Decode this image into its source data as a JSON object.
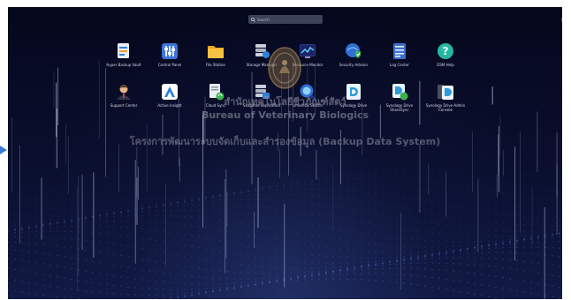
{
  "search": {
    "placeholder": "Search"
  },
  "apps": [
    {
      "label": "Hyper Backup Vault",
      "icon": "hyper-backup-icon"
    },
    {
      "label": "Control Panel",
      "icon": "control-panel-icon"
    },
    {
      "label": "File Station",
      "icon": "file-station-icon"
    },
    {
      "label": "Storage Manager",
      "icon": "storage-manager-icon"
    },
    {
      "label": "Resource Monitor",
      "icon": "resource-monitor-icon"
    },
    {
      "label": "Security Advisor",
      "icon": "security-advisor-icon"
    },
    {
      "label": "Log Center",
      "icon": "log-center-icon"
    },
    {
      "label": "DSM Help",
      "icon": "help-icon"
    },
    {
      "label": "Support Center",
      "icon": "support-center-icon"
    },
    {
      "label": "Active Insight",
      "icon": "active-insight-icon"
    },
    {
      "label": "Cloud Sync",
      "icon": "cloud-sync-icon"
    },
    {
      "label": "Snapshot Replication",
      "icon": "snapshot-icon"
    },
    {
      "label": "Universal Search",
      "icon": "universal-search-icon"
    },
    {
      "label": "Synology Drive",
      "icon": "synology-drive-icon"
    },
    {
      "label": "Synology Drive ShareSync",
      "icon": "drive-sharesync-icon"
    },
    {
      "label": "Synology Drive Admin Console",
      "icon": "drive-admin-console-icon"
    }
  ],
  "watermark": {
    "org_thai": "สำนักเทคโนโลยีชีวภัณฑ์สัตว์",
    "org_english": "Bureau of Veterinary Biologics",
    "project": "โครงการพัฒนาระบบจัดเก็บและสำรองข้อมูล (Backup Data System)"
  },
  "colors": {
    "background": "#070a22",
    "accent": "#3a7bd5",
    "label_text": "#d8dcea"
  }
}
